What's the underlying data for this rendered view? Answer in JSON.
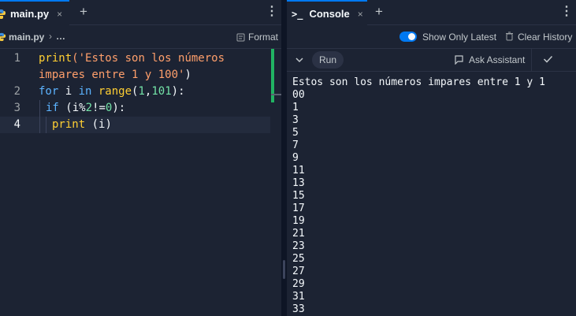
{
  "editor_tab": {
    "label": "main.py",
    "close": "×"
  },
  "new_tab": "+",
  "menu": "⋮",
  "breadcrumb": {
    "file": "main.py",
    "sep": "›",
    "more": "…"
  },
  "format_button": {
    "label": "Format"
  },
  "code_lines": [
    {
      "num": "1"
    },
    {
      "num": ""
    },
    {
      "num": "2"
    },
    {
      "num": "3"
    },
    {
      "num": "4"
    }
  ],
  "code": {
    "l1_fn": "print",
    "l1_str": "('Estos son los números",
    "l1b_str": "impares entre 1 y 100'",
    "l1b_close": ")",
    "l2_for": "for",
    "l2_i": " i ",
    "l2_in": "in",
    "l2_range": " range",
    "l2_paren": "(",
    "l2_a": "1",
    "l2_comma": ",",
    "l2_b": "101",
    "l2_end": "):",
    "l3_if": "if",
    "l3_a": " (i%",
    "l3_two": "2",
    "l3_ne": "!=",
    "l3_zero": "0",
    "l3_end": "):",
    "l4_print": "print",
    "l4_rest": " (i)"
  },
  "console_tab": {
    "label": "Console",
    "prompt_icon": ">_",
    "close": "×"
  },
  "show_only_latest": {
    "label": "Show Only Latest",
    "on": true
  },
  "clear_history": {
    "label": "Clear History"
  },
  "run_button": {
    "label": "Run"
  },
  "ask_assistant": {
    "label": "Ask Assistant"
  },
  "output_lines": [
    "Estos son los números impares entre 1 y 1",
    "00",
    "1",
    "3",
    "5",
    "7",
    "9",
    "11",
    "13",
    "15",
    "17",
    "19",
    "21",
    "23",
    "25",
    "27",
    "29",
    "31",
    "33"
  ],
  "colors": {
    "accent": "#0079f2",
    "success": "#21b463",
    "bg": "#1c2333"
  }
}
